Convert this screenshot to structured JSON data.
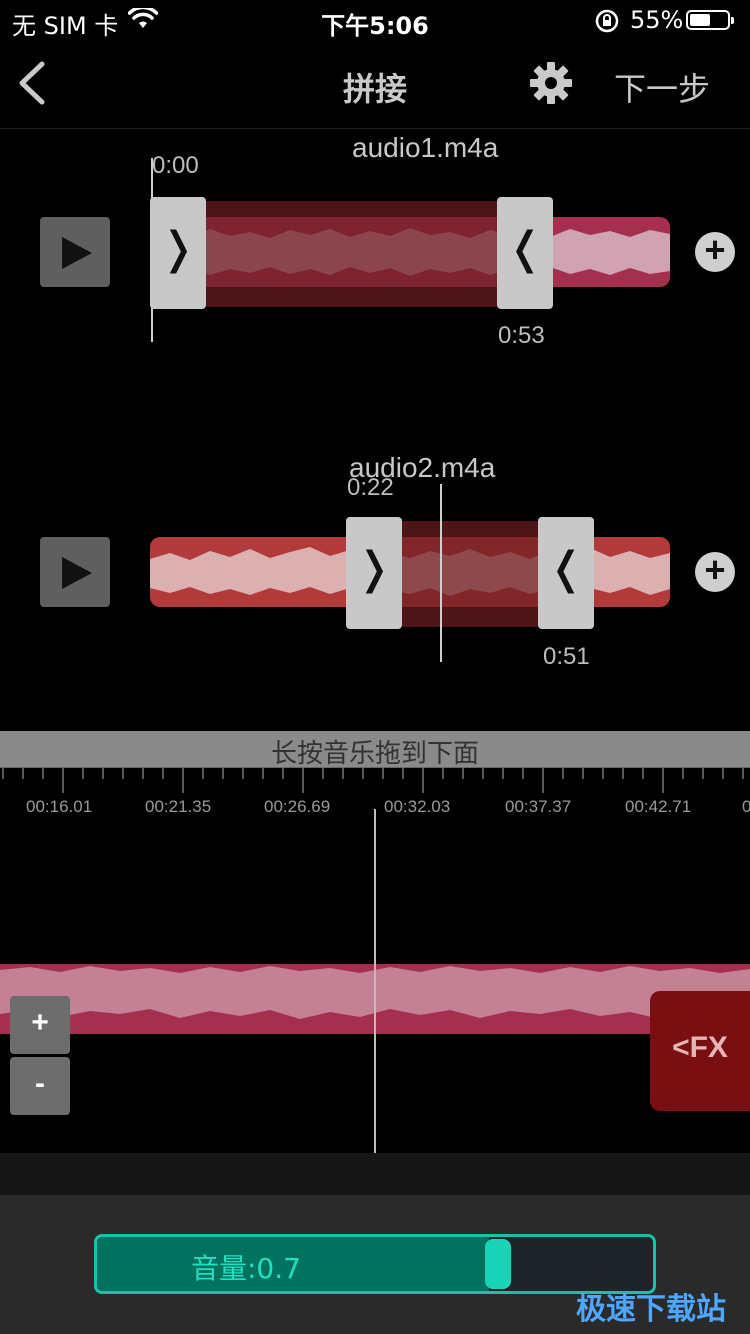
{
  "status_bar": {
    "carrier": "无 SIM 卡",
    "time": "下午5:06",
    "battery": "55%",
    "battery_level": 0.55
  },
  "nav": {
    "title": "拼接",
    "next": "下一步",
    "icons": [
      "back-chevron-icon",
      "gear-icon"
    ]
  },
  "tracks": [
    {
      "filename": "audio1.m4a",
      "start": "0:00",
      "end": "0:53",
      "wave_color": "#a52f4f",
      "selected_color": "#6d1e22"
    },
    {
      "filename": "audio2.m4a",
      "start": "0:22",
      "end": "0:51",
      "wave_color": "#b23a3a",
      "selected_color": "#6d1e22"
    }
  ],
  "hint": "长按音乐拖到下面",
  "ruler_labels": [
    "00:16.01",
    "00:21.35",
    "00:26.69",
    "00:32.03",
    "00:37.37",
    "00:42.71",
    "0"
  ],
  "timeline": {
    "zoom_in": "+",
    "zoom_out": "-",
    "fx": "<FX"
  },
  "volume": {
    "label": "音量:0.7",
    "value": 0.7,
    "accent": "#16c3a8"
  },
  "watermark": "极速下载站"
}
